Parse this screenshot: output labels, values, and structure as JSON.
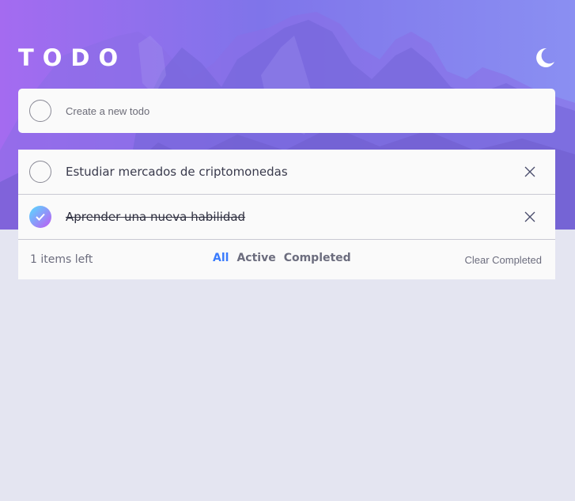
{
  "header": {
    "title": "TODO",
    "theme_icon": "moon-icon"
  },
  "new_todo": {
    "placeholder": "Create a new todo",
    "value": ""
  },
  "todos": [
    {
      "text": "Estudiar mercados de criptomonedas",
      "completed": false
    },
    {
      "text": "Aprender una nueva habilidad",
      "completed": true
    }
  ],
  "footer": {
    "items_left": "1 items left",
    "filters": [
      "All",
      "Active",
      "Completed"
    ],
    "active_filter": "All",
    "clear_label": "Clear Completed"
  },
  "colors": {
    "accent": "#3a7bfd",
    "page_background": "#e4e5f1",
    "card_background": "#fafafa",
    "check_gradient_start": "#55ddff",
    "check_gradient_end": "#c058f3"
  }
}
